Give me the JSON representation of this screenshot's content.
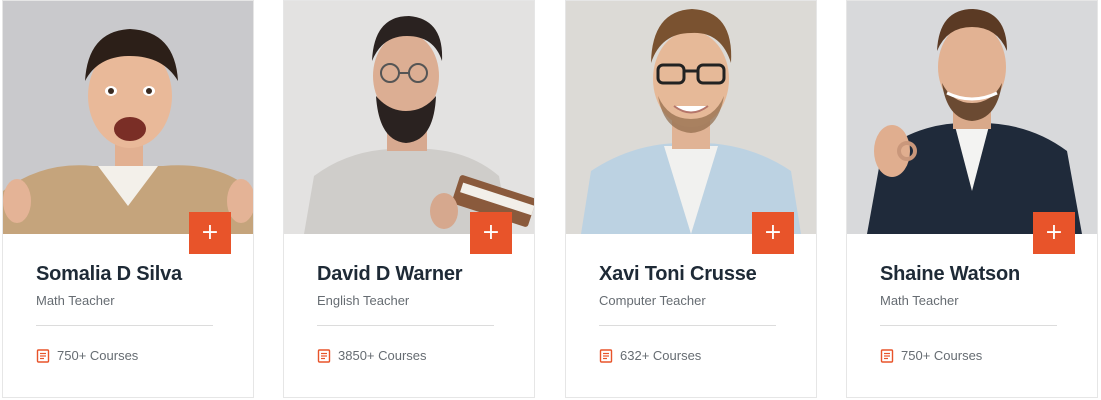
{
  "accent_color": "#e8542a",
  "teachers": [
    {
      "name": "Somalia D Silva",
      "role": "Math Teacher",
      "courses": "750+ Courses",
      "action_label": "+",
      "icon": "plus-icon",
      "courses_icon": "book-icon"
    },
    {
      "name": "David D Warner",
      "role": "English Teacher",
      "courses": "3850+ Courses",
      "action_label": "+",
      "icon": "plus-icon",
      "courses_icon": "book-icon"
    },
    {
      "name": "Xavi Toni Crusse",
      "role": "Computer Teacher",
      "courses": "632+ Courses",
      "action_label": "+",
      "icon": "plus-icon",
      "courses_icon": "book-icon"
    },
    {
      "name": "Shaine Watson",
      "role": "Math Teacher",
      "courses": "750+ Courses",
      "action_label": "+",
      "icon": "plus-icon",
      "courses_icon": "book-icon"
    }
  ]
}
